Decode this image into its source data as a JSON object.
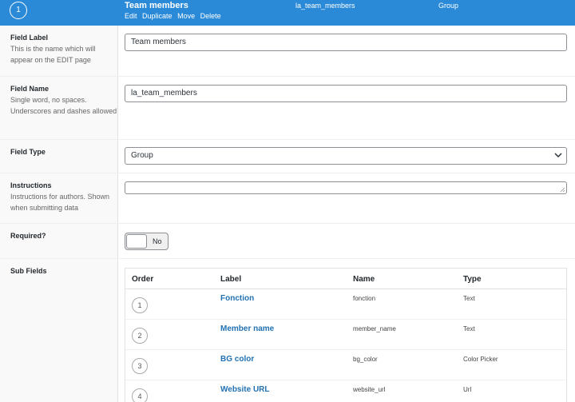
{
  "header": {
    "order": "1",
    "label": "Team members",
    "actions": [
      "Edit",
      "Duplicate",
      "Move",
      "Delete"
    ],
    "name": "la_team_members",
    "type": "Group"
  },
  "field_label": {
    "title": "Field Label",
    "desc": "This is the name which will appear on the EDIT page",
    "value": "Team members"
  },
  "field_name": {
    "title": "Field Name",
    "desc": "Single word, no spaces. Underscores and dashes allowed",
    "value": "la_team_members"
  },
  "field_type": {
    "title": "Field Type",
    "value": "Group"
  },
  "instructions": {
    "title": "Instructions",
    "desc": "Instructions for authors. Shown when submitting data",
    "value": ""
  },
  "required": {
    "title": "Required?",
    "toggle_text": "No"
  },
  "sub_fields": {
    "title": "Sub Fields",
    "columns": {
      "order": "Order",
      "label": "Label",
      "name": "Name",
      "type": "Type"
    },
    "rows": [
      {
        "order": "1",
        "label": "Fonction",
        "name": "fonction",
        "type": "Text"
      },
      {
        "order": "2",
        "label": "Member name",
        "name": "member_name",
        "type": "Text"
      },
      {
        "order": "3",
        "label": "BG color",
        "name": "bg_color",
        "type": "Color Picker"
      },
      {
        "order": "4",
        "label": "Website URL",
        "name": "website_url",
        "type": "Url"
      }
    ]
  },
  "colors": {
    "header_bg": "#2a8ad8",
    "link": "#2271b1"
  }
}
